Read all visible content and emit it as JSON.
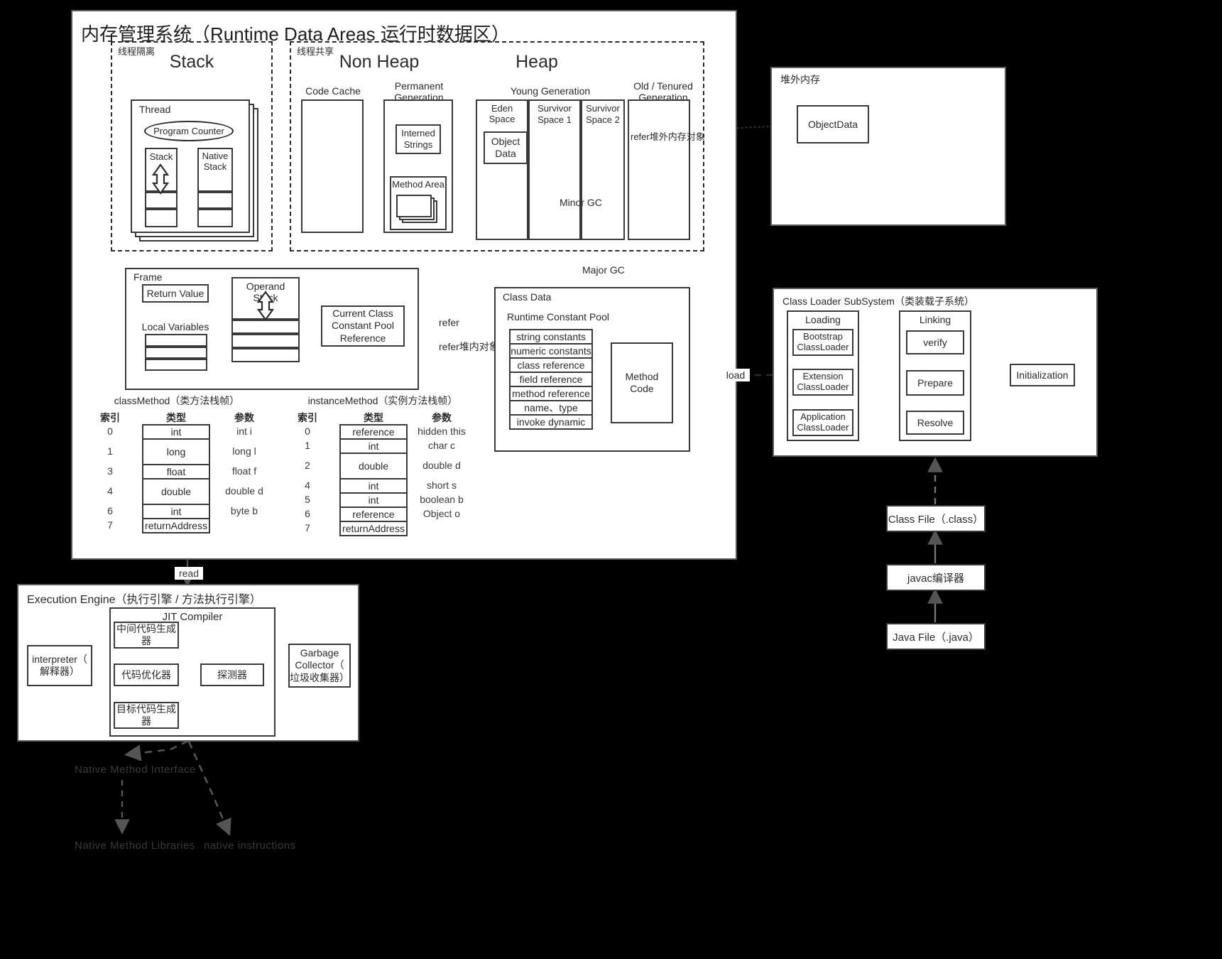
{
  "runtime_panel": {
    "title": "内存管理系统（Runtime Data Areas 运行时数据区）",
    "stack_group": {
      "tag": "线程隔离",
      "title": "Stack"
    },
    "shared_group": {
      "tag": "线程共享"
    },
    "thread": {
      "title": "Thread",
      "program_counter": "Program Counter",
      "stack": "Stack",
      "native_stack": "Native Stack"
    },
    "non_heap": {
      "title": "Non Heap",
      "code_cache": "Code Cache",
      "permanent_generation": "Permanent\nGeneration",
      "interned_strings": "Interned\nStrings",
      "method_area": "Method Area"
    },
    "heap": {
      "title": "Heap",
      "young_generation": "Young Generation",
      "eden_space": "Eden Space",
      "survivor_space_1": "Survivor\nSpace 1",
      "survivor_space_2": "Survivor\nSpace 2",
      "object_data": "Object\nData",
      "old_tenured": "Old / Tenured\nGeneration",
      "minor_gc": "Minor GC",
      "major_gc": "Major GC"
    },
    "frame": {
      "title": "Frame",
      "return_value": "Return Value",
      "local_variables": "Local Variables",
      "operand_stack": "Operand Stack",
      "current_class_constant_pool_reference": "Current Class\nConstant Pool\nReference"
    },
    "class_data": {
      "title": "Class Data",
      "runtime_constant_pool": "Runtime Constant Pool",
      "pool_entries": [
        "string constants",
        "numeric constants",
        "class reference",
        "field reference",
        "method reference",
        "name、type",
        "invoke dynamic"
      ],
      "method_code": "Method\nCode"
    },
    "tables": {
      "headers": [
        "索引",
        "类型",
        "参数"
      ],
      "class_method": {
        "caption": "classMethod（类方法栈帧）",
        "rows": [
          {
            "index": "0",
            "type": "int",
            "param": "int i",
            "tall": false
          },
          {
            "index": "1",
            "type": "long",
            "param": "long l",
            "tall": true
          },
          {
            "index": "3",
            "type": "float",
            "param": "float f",
            "tall": false
          },
          {
            "index": "4",
            "type": "double",
            "param": "double d",
            "tall": true
          },
          {
            "index": "6",
            "type": "int",
            "param": "byte b",
            "tall": false
          },
          {
            "index": "7",
            "type": "returnAddress",
            "param": "",
            "tall": false
          }
        ]
      },
      "instance_method": {
        "caption": "instanceMethod（实例方法栈帧）",
        "rows": [
          {
            "index": "0",
            "type": "reference",
            "param": "hidden this",
            "tall": false
          },
          {
            "index": "1",
            "type": "int",
            "param": "char c",
            "tall": false
          },
          {
            "index": "2",
            "type": "double",
            "param": "double d",
            "tall": true
          },
          {
            "index": "4",
            "type": "int",
            "param": "short s",
            "tall": false
          },
          {
            "index": "5",
            "type": "int",
            "param": "boolean b",
            "tall": false
          },
          {
            "index": "6",
            "type": "reference",
            "param": "Object o",
            "tall": false
          },
          {
            "index": "7",
            "type": "returnAddress",
            "param": "",
            "tall": false
          }
        ]
      }
    },
    "edge_labels": {
      "refer_offheap": "refer堆外内存对象",
      "refer": "refer",
      "refer_inheap": "refer堆内对象"
    }
  },
  "off_heap_panel": {
    "title": "堆外内存",
    "object_data": "ObjectData"
  },
  "class_loader_panel": {
    "title": "Class Loader SubSystem（类装载子系统）",
    "loading": {
      "title": "Loading",
      "items": [
        "Bootstrap\nClassLoader",
        "Extension\nClassLoader",
        "Application\nClassLoader"
      ]
    },
    "linking": {
      "title": "Linking",
      "items": [
        "verify",
        "Prepare",
        "Resolve"
      ]
    },
    "initialization": "Initialization",
    "load_label": "load"
  },
  "compile_chain": {
    "class_file": "Class File（.class）",
    "javac": "javac编译器",
    "java_file": "Java File（.java）"
  },
  "execution_engine_panel": {
    "title": "Execution Engine（执行引擎 / 方法执行引擎）",
    "interpreter": "interpreter（\n解释器）",
    "jit": {
      "title": "JIT Compiler",
      "intermediate": "中间代码生成\n器",
      "optimizer": "代码优化器",
      "profiler": "探测器",
      "target": "目标代码生成\n器"
    },
    "garbage_collector": "Garbage\nCollector（\n垃圾收集器）",
    "read_label": "read"
  },
  "native_section": {
    "native_method_interface": "Native Method Interface",
    "native_method_libraries": "Native Method Libraries",
    "native_instructions": "native instructions"
  }
}
